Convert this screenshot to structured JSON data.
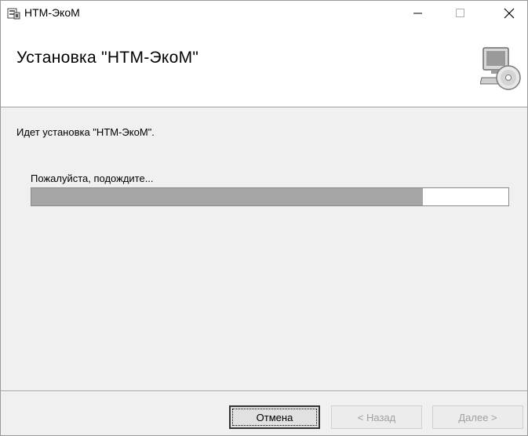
{
  "window": {
    "title": "НТМ-ЭкоМ",
    "controls": {
      "minimize": "—",
      "maximize": "☐",
      "close": "✕"
    }
  },
  "banner": {
    "title": "Установка \"НТМ-ЭкоМ\"",
    "icon": "setup-computer-disc-icon"
  },
  "content": {
    "status": "Идет установка \"НТМ-ЭкоМ\".",
    "wait_label": "Пожалуйста, подождите...",
    "progress_fraction": 0.82
  },
  "footer": {
    "cancel_label": "Отмена",
    "back_label": "< Назад",
    "next_label": "Далее >"
  },
  "colors": {
    "progress_fill": "#a6a6a6",
    "disabled_text": "#a0a0a0"
  }
}
